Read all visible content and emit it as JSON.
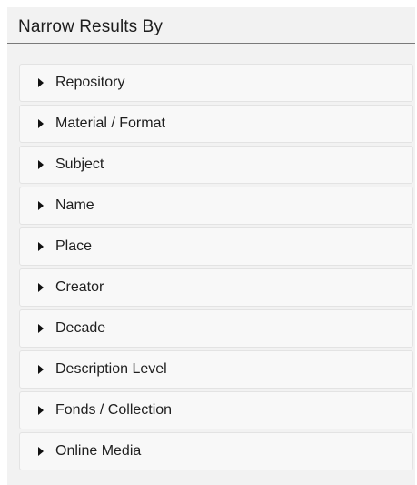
{
  "sidebar": {
    "title": "Narrow Results By",
    "facets": [
      {
        "label": "Repository",
        "icon": "caret-right-icon"
      },
      {
        "label": "Material / Format",
        "icon": "caret-right-icon"
      },
      {
        "label": "Subject",
        "icon": "caret-right-icon"
      },
      {
        "label": "Name",
        "icon": "caret-right-icon"
      },
      {
        "label": "Place",
        "icon": "caret-right-icon"
      },
      {
        "label": "Creator",
        "icon": "caret-right-icon"
      },
      {
        "label": "Decade",
        "icon": "caret-right-icon"
      },
      {
        "label": "Description Level",
        "icon": "caret-right-icon"
      },
      {
        "label": "Fonds / Collection",
        "icon": "caret-right-icon"
      },
      {
        "label": "Online Media",
        "icon": "caret-right-icon"
      }
    ]
  },
  "colors": {
    "panel_background": "#f2f2f2",
    "item_background": "#f8f8f8",
    "item_border": "#e3e3e3",
    "divider": "#7a7a7a",
    "text": "#1e1e1e"
  }
}
